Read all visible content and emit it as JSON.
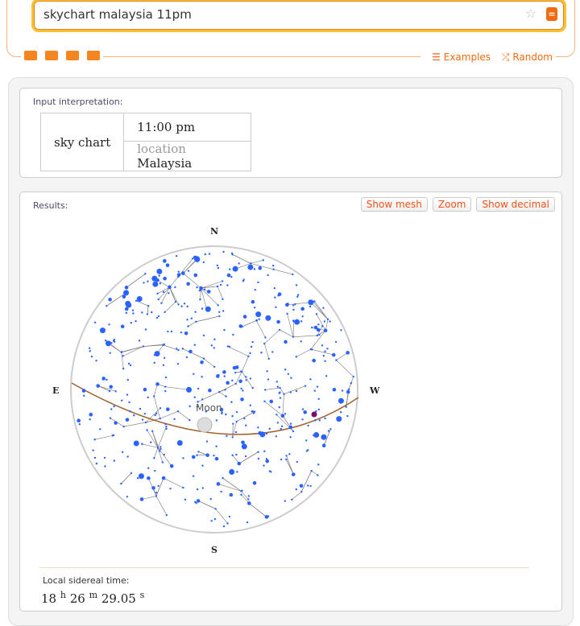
{
  "search": {
    "query": "skychart malaysia 11pm",
    "examples": "Examples",
    "random": "Random"
  },
  "toolbar_icons": [
    "keyboard-icon",
    "camera-icon",
    "table-icon",
    "upload-icon"
  ],
  "input_pod": {
    "title": "Input interpretation:",
    "subject": "sky chart",
    "time": "11:00 pm",
    "location_label": "location",
    "location": "Malaysia"
  },
  "results_pod": {
    "title": "Results:",
    "buttons": [
      "Show mesh",
      "Zoom",
      "Show decimal"
    ],
    "compass": {
      "n": "N",
      "s": "S",
      "e": "E",
      "w": "W"
    },
    "moon_label": "Moon",
    "sidereal_label": "Local sidereal time:",
    "sidereal": {
      "h": "18",
      "m": "26",
      "s": "29.05",
      "hu": "h",
      "mu": "m",
      "su": "s"
    }
  },
  "colors": {
    "accent": "#f26a10",
    "star": "#2962ff",
    "ecliptic": "#a0602a",
    "planet": "#7a0a6a"
  }
}
